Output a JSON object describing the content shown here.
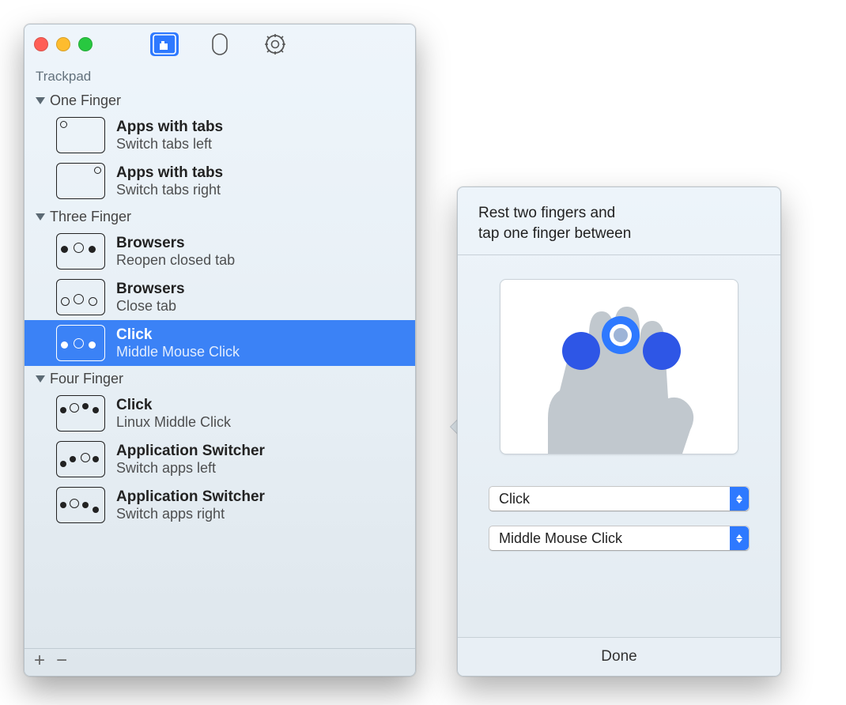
{
  "window": {
    "sub_label": "Trackpad",
    "tabs": [
      "trackpad",
      "mouse",
      "settings"
    ]
  },
  "sections": {
    "one_finger": {
      "label": "One Finger",
      "items": [
        {
          "title": "Apps with tabs",
          "sub": "Switch tabs left"
        },
        {
          "title": "Apps with tabs",
          "sub": "Switch tabs right"
        }
      ]
    },
    "three_finger": {
      "label": "Three Finger",
      "items": [
        {
          "title": "Browsers",
          "sub": "Reopen closed tab"
        },
        {
          "title": "Browsers",
          "sub": "Close tab"
        },
        {
          "title": "Click",
          "sub": "Middle Mouse Click"
        }
      ]
    },
    "four_finger": {
      "label": "Four Finger",
      "items": [
        {
          "title": "Click",
          "sub": "Linux Middle Click"
        },
        {
          "title": "Application Switcher",
          "sub": "Switch apps left"
        },
        {
          "title": "Application Switcher",
          "sub": "Switch apps right"
        }
      ]
    }
  },
  "detail": {
    "heading_line1": "Rest two fingers and",
    "heading_line2": "tap one finger between",
    "select_action": "Click",
    "select_result": "Middle Mouse Click",
    "done": "Done"
  },
  "footer": {
    "add": "+",
    "remove": "−"
  }
}
